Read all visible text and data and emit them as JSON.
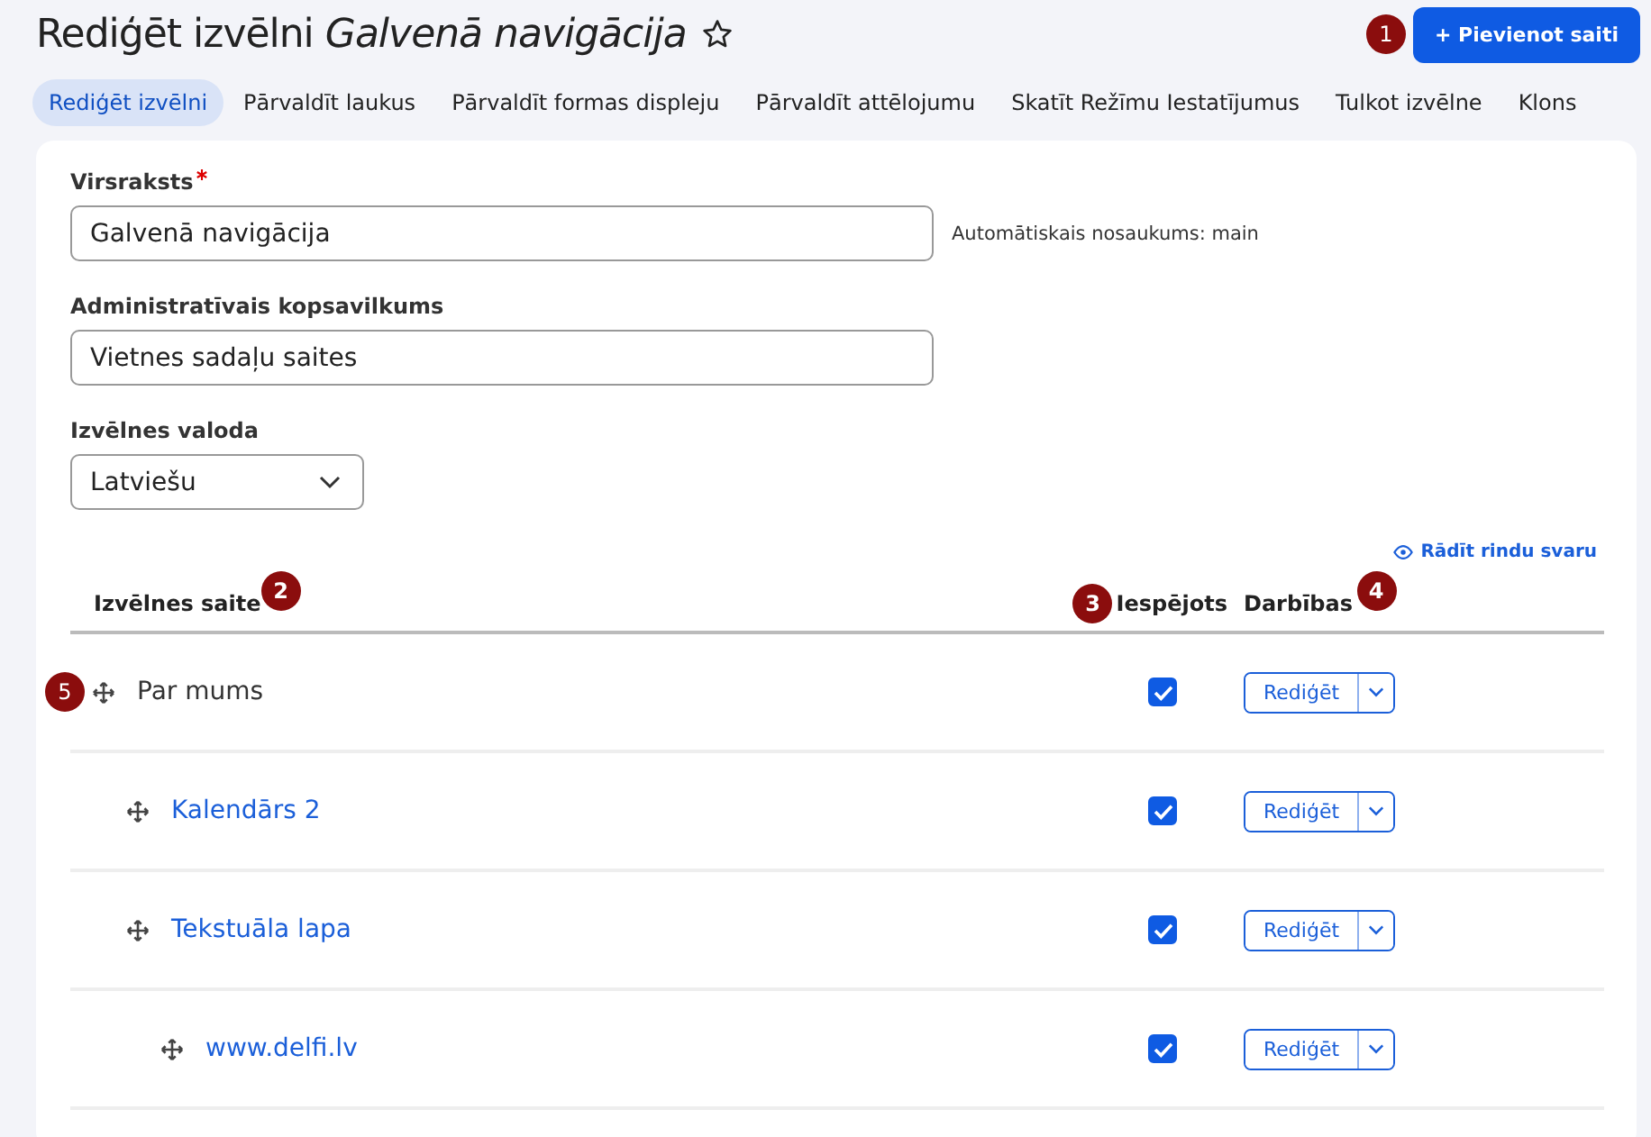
{
  "page": {
    "title_prefix": "Rediģēt izvēlni",
    "title_name": "Galvenā navigācija",
    "starred": false,
    "add_button": {
      "label": "+ Pievienot saiti",
      "marker": "1"
    }
  },
  "tabs": [
    {
      "label": "Rediģēt izvēlni",
      "selected": true
    },
    {
      "label": "Pārvaldīt laukus",
      "selected": false
    },
    {
      "label": "Pārvaldīt formas displeju",
      "selected": false
    },
    {
      "label": "Pārvaldīt attēlojumu",
      "selected": false
    },
    {
      "label": "Skatīt Režīmu Iestatījumus",
      "selected": false
    },
    {
      "label": "Tulkot izvēlne",
      "selected": false
    },
    {
      "label": "Klons",
      "selected": false
    }
  ],
  "form": {
    "title_field": {
      "label": "Virsraksts",
      "required": true,
      "value": "Galvenā navigācija",
      "machine_name": "Automātiskais nosaukums: main"
    },
    "summary_field": {
      "label": "Administratīvais kopsavilkums",
      "value": "Vietnes sadaļu saites"
    },
    "language_field": {
      "label": "Izvēlnes valoda",
      "value": "Latviešu"
    }
  },
  "table": {
    "weights_link": "Rādīt rindu svaru",
    "columns": [
      {
        "label": "Izvēlnes saite",
        "marker": "2"
      },
      {
        "label": "Iespējots",
        "marker": "3"
      },
      {
        "label": "Darbības",
        "marker": "4"
      }
    ],
    "rows": [
      {
        "title": "Par mums",
        "kind": "text",
        "enabled": true,
        "action": "Rediģēt",
        "marker": "5",
        "children": [
          {
            "title": "Kalendārs 2",
            "kind": "link",
            "enabled": true,
            "action": "Rediģēt"
          },
          {
            "title": "Tekstuāla lapa",
            "kind": "link",
            "enabled": true,
            "action": "Rediģēt",
            "children": [
              {
                "title": "www.delfi.lv",
                "kind": "link",
                "enabled": true,
                "action": "Rediģēt"
              }
            ]
          }
        ]
      }
    ]
  }
}
